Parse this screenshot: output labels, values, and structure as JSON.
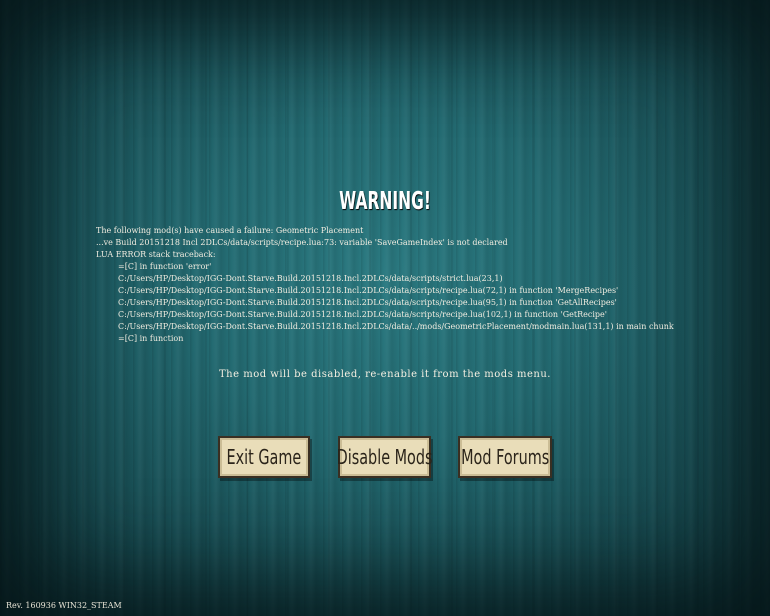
{
  "title": "WARNING!",
  "error_lines": [
    "The following mod(s) have caused a failure: Geometric Placement",
    "...ve Build 20151218 Incl 2DLCs/data/scripts/recipe.lua:73: variable 'SaveGameIndex' is not declared",
    "LUA ERROR stack traceback:",
    "=[C] in function 'error'",
    "C:/Users/HP/Desktop/IGG-Dont.Starve.Build.20151218.Incl.2DLCs/data/scripts/strict.lua(23,1)",
    "C:/Users/HP/Desktop/IGG-Dont.Starve.Build.20151218.Incl.2DLCs/data/scripts/recipe.lua(72,1) in function 'MergeRecipes'",
    "C:/Users/HP/Desktop/IGG-Dont.Starve.Build.20151218.Incl.2DLCs/data/scripts/recipe.lua(95,1) in function 'GetAllRecipes'",
    "C:/Users/HP/Desktop/IGG-Dont.Starve.Build.20151218.Incl.2DLCs/data/scripts/recipe.lua(102,1) in function 'GetRecipe'",
    "C:/Users/HP/Desktop/IGG-Dont.Starve.Build.20151218.Incl.2DLCs/data/../mods/GeometricPlacement/modmain.lua(131,1) in main chunk",
    "=[C] in function"
  ],
  "disable_note": "The mod will be disabled, re-enable it from the mods menu.",
  "buttons": {
    "exit": "Exit Game",
    "disable": "Disable Mods",
    "forums": "Mod Forums"
  },
  "revision": "Rev. 160936 WIN32_STEAM"
}
